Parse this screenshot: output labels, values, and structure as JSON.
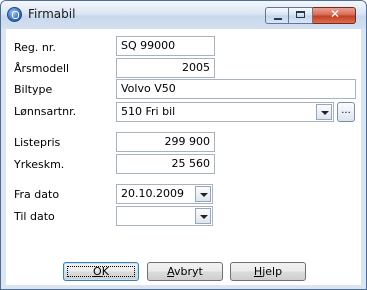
{
  "window": {
    "title": "Firmabil",
    "close_glyph": "✕"
  },
  "form": {
    "reg_nr": {
      "label": "Reg. nr.",
      "value": "SQ 99000"
    },
    "arsmodell": {
      "label": "Årsmodell",
      "value": "2005"
    },
    "biltype": {
      "label": "Biltype",
      "value": "Volvo V50"
    },
    "lonnsartnr": {
      "label": "Lønnsartnr.",
      "value": "510 Fri bil",
      "browse_label": "..."
    },
    "listepris": {
      "label": "Listepris",
      "value": "299 900"
    },
    "yrkeskm": {
      "label": "Yrkeskm.",
      "value": "25 560"
    },
    "fra_dato": {
      "label": "Fra dato",
      "value": "20.10.2009"
    },
    "til_dato": {
      "label": "Til dato",
      "value": " .  ."
    }
  },
  "buttons": {
    "ok": {
      "accel": "O",
      "rest": "K"
    },
    "cancel": {
      "accel": "A",
      "rest": "vbryt"
    },
    "help": {
      "accel": "H",
      "rest": "jelp"
    }
  },
  "icons": [
    "app-icon",
    "minimize-icon",
    "maximize-icon",
    "close-icon",
    "dropdown-arrow-icon"
  ]
}
